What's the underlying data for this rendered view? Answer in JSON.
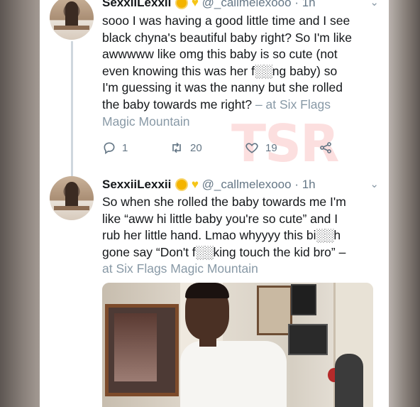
{
  "tweets": [
    {
      "display_name": "SexxiiLexxii",
      "handle": "@_callmelexooo",
      "separator": "·",
      "time": "1h",
      "lines": [
        "sooo I was having a good little time and I see",
        "black chyna's beautiful baby right? So I'm like",
        "awwwww like omg this baby is so cute (not",
        "even knowing this was her f░░ng baby) so",
        "I'm guessing it was the nanny but she rolled",
        "the baby towards me right? ",
        "Magic Mountain"
      ],
      "location_prefix": "– at Six Flags",
      "reply_count": "1",
      "retweet_count": "20",
      "like_count": "19"
    },
    {
      "display_name": "SexxiiLexxii",
      "handle": "@_callmelexooo",
      "separator": "·",
      "time": "1h",
      "lines": [
        "So when she rolled the baby towards me I'm",
        "like “aww hi little baby you're so cute” and I",
        "rub her little hand. Lmao whyyyy this bi░░h",
        "gone say “Don't f░░king touch the kid bro” –"
      ],
      "location": "at Six Flags Magic Mountain"
    }
  ],
  "watermark": "TSR",
  "colors": {
    "text": "#14171a",
    "secondary": "#657786",
    "location": "#8899a6",
    "watermark": "#f05050"
  },
  "icons": {
    "reply": "reply-icon",
    "retweet": "retweet-icon",
    "like": "heart-icon",
    "share": "share-icon",
    "more": "chevron-down-icon"
  }
}
